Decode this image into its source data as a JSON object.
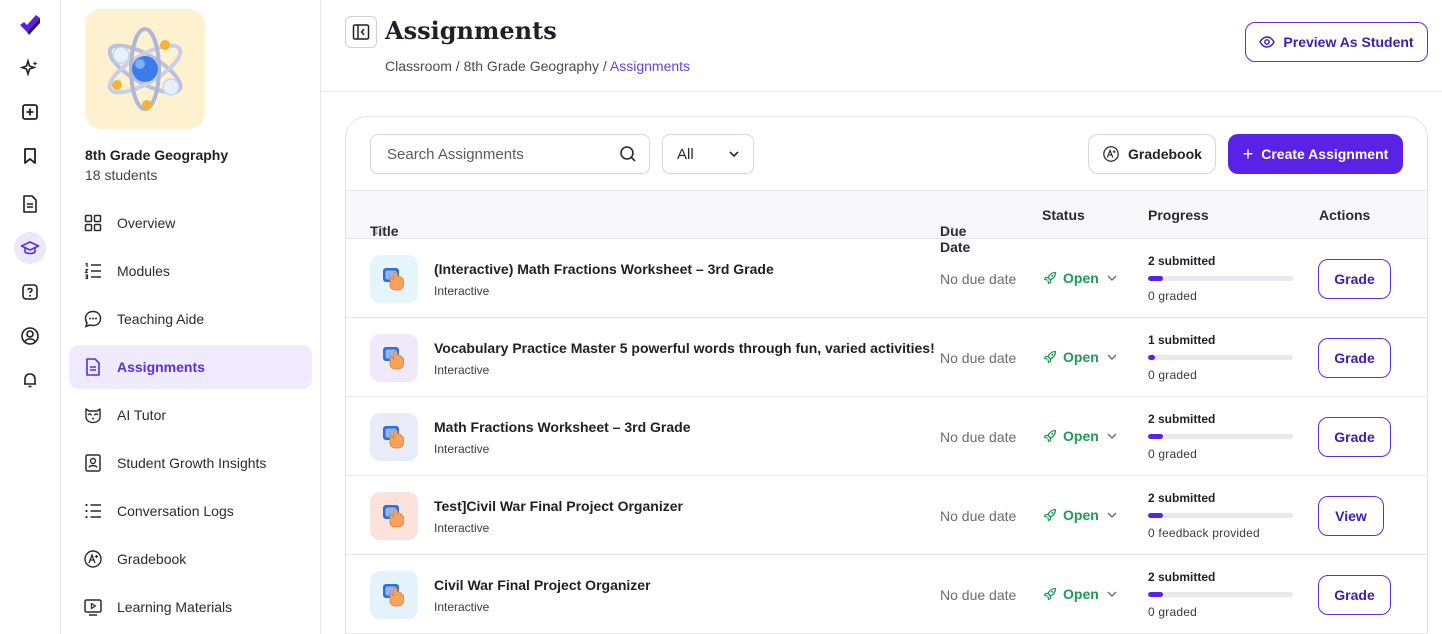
{
  "class": {
    "name": "8th Grade Geography",
    "students": "18 students"
  },
  "nav": [
    {
      "label": "Overview",
      "icon": "grid-icon"
    },
    {
      "label": "Modules",
      "icon": "list-numbered-icon"
    },
    {
      "label": "Teaching Aide",
      "icon": "chat-bubble-icon"
    },
    {
      "label": "Assignments",
      "icon": "document-icon",
      "active": true
    },
    {
      "label": "AI Tutor",
      "icon": "raccoon-icon"
    },
    {
      "label": "Student Growth Insights",
      "icon": "contact-card-icon"
    },
    {
      "label": "Conversation Logs",
      "icon": "list-bullet-icon"
    },
    {
      "label": "Gradebook",
      "icon": "grade-icon"
    },
    {
      "label": "Learning Materials",
      "icon": "video-play-icon"
    }
  ],
  "header": {
    "title": "Assignments",
    "breadcrumb": [
      "Classroom",
      "8th Grade Geography",
      "Assignments"
    ],
    "separator": "/",
    "preview_label": "Preview As Student"
  },
  "toolbar": {
    "search_placeholder": "Search Assignments",
    "filter_value": "All",
    "gradebook_label": "Gradebook",
    "create_label": "Create Assignment",
    "create_plus": "+"
  },
  "table": {
    "headers": {
      "title": "Title",
      "due": "Due Date",
      "status": "Status",
      "progress": "Progress",
      "actions": "Actions"
    },
    "sort_glyph": "↓↑",
    "rows": [
      {
        "title": "(Interactive) Math Fractions Worksheet – 3rd Grade",
        "type": "Interactive",
        "due": "No due date",
        "status": "Open",
        "submitted": "2 submitted",
        "progress_fraction": 0.1,
        "graded": "0 graded",
        "action": "Grade",
        "thumb_color": "#e6f4fb"
      },
      {
        "title": "Vocabulary Practice Master 5 powerful words through fun, varied activities!",
        "type": "Interactive",
        "due": "No due date",
        "status": "Open",
        "submitted": "1 submitted",
        "progress_fraction": 0.05,
        "graded": "0 graded",
        "action": "Grade",
        "thumb_color": "#efe9fb"
      },
      {
        "title": "Math Fractions Worksheet – 3rd Grade",
        "type": "Interactive",
        "due": "No due date",
        "status": "Open",
        "submitted": "2 submitted",
        "progress_fraction": 0.1,
        "graded": "0 graded",
        "action": "Grade",
        "thumb_color": "#e9ebf9"
      },
      {
        "title": "Test]Civil War Final Project Organizer",
        "type": "Interactive",
        "due": "No due date",
        "status": "Open",
        "submitted": "2 submitted",
        "progress_fraction": 0.1,
        "graded": "0 feedback provided",
        "action": "View",
        "thumb_color": "#fbe3dc"
      },
      {
        "title": "Civil War Final Project Organizer",
        "type": "Interactive",
        "due": "No due date",
        "status": "Open",
        "submitted": "2 submitted",
        "progress_fraction": 0.1,
        "graded": "0 graded",
        "action": "Grade",
        "thumb_color": "#e4f2fb"
      }
    ]
  },
  "colors": {
    "accent": "#5a21e6",
    "status_open": "#1f9a55"
  }
}
